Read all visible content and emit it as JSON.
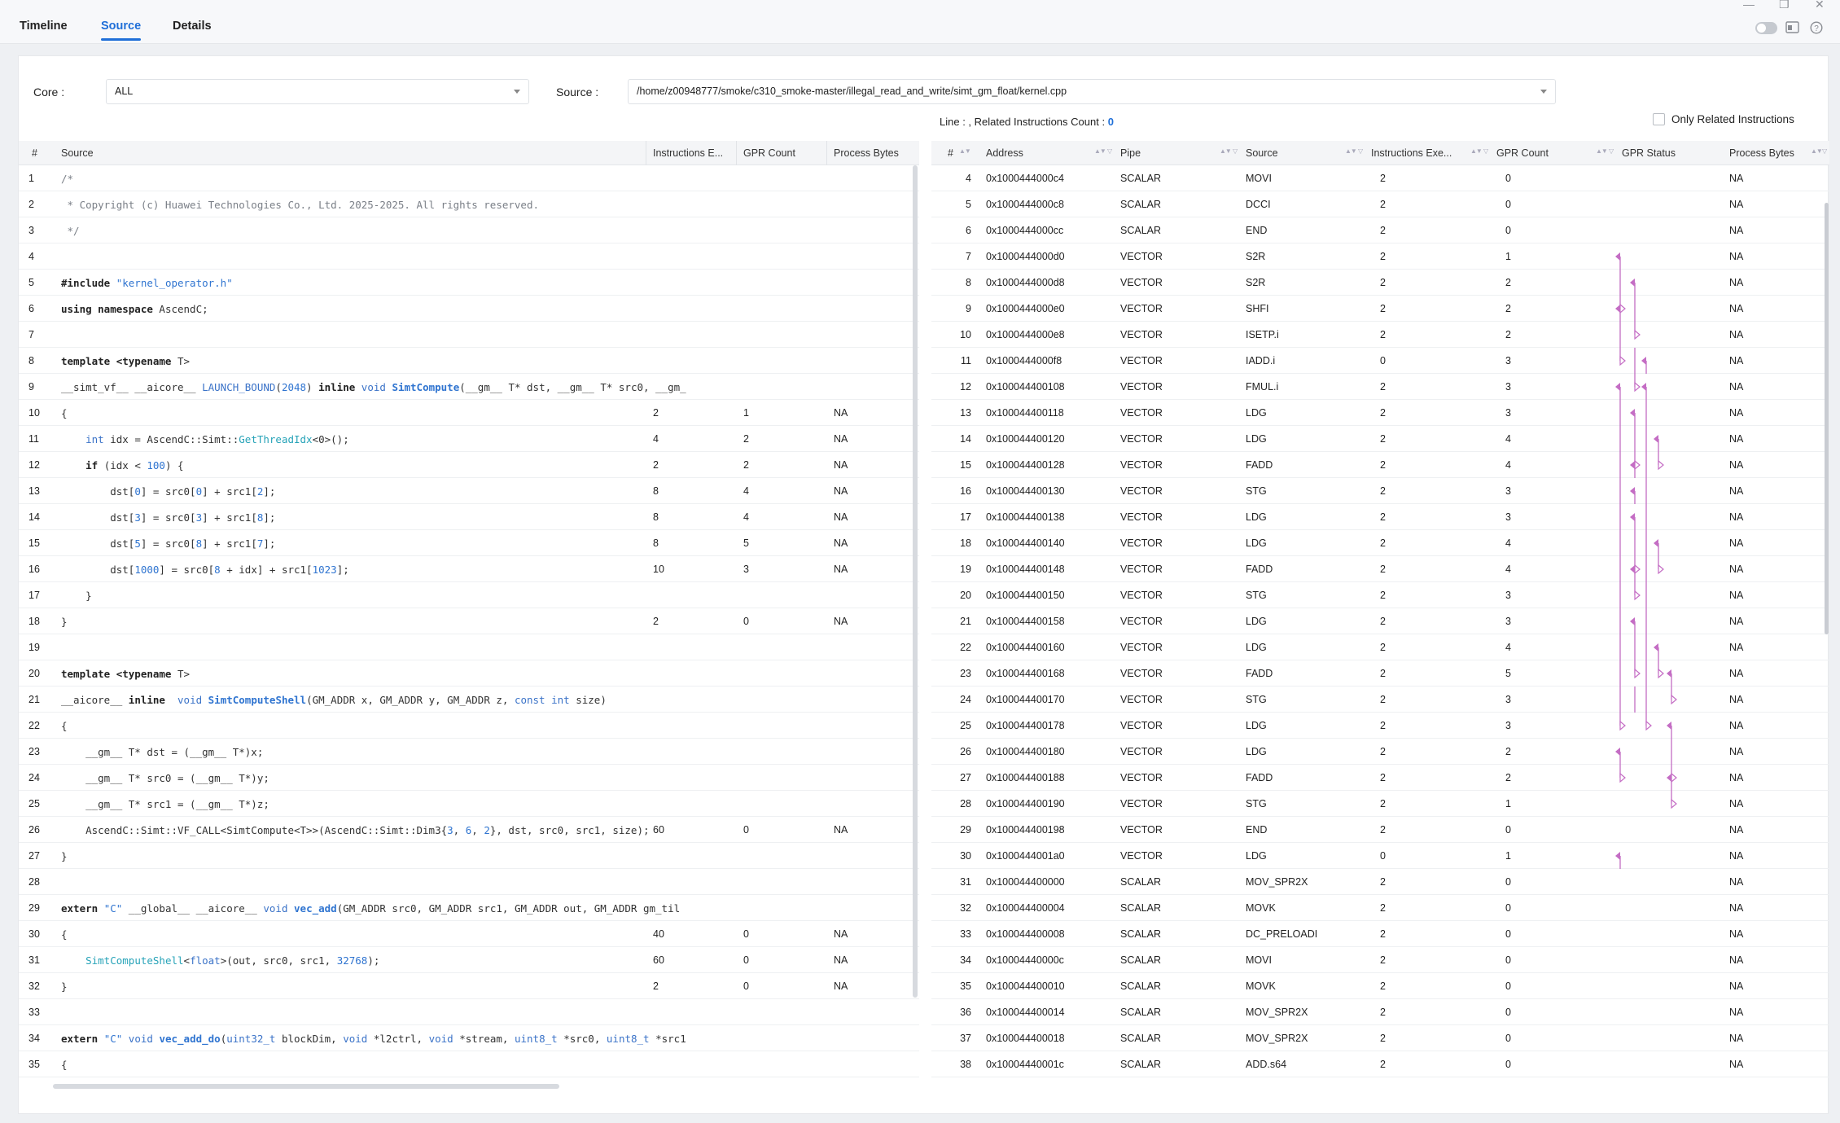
{
  "tabs": [
    {
      "label": "Timeline"
    },
    {
      "label": "Source"
    },
    {
      "label": "Details"
    }
  ],
  "filters": {
    "core_label": "Core :",
    "core_value": "ALL",
    "source_label": "Source :",
    "source_value": "/home/z00948777/smoke/c310_smoke-master/illegal_read_and_write/simt_gm_float/kernel.cpp"
  },
  "info": {
    "line_label": "Line : , Related Instructions Count :",
    "count": "0"
  },
  "only_related": {
    "label": "Only Related Instructions",
    "checked": false
  },
  "left_headers": [
    "#",
    "Source",
    "Instructions E...",
    "GPR Count",
    "Process Bytes"
  ],
  "right_headers": [
    "#",
    "Address",
    "Pipe",
    "Source",
    "Instructions Exe...",
    "GPR Count",
    "GPR Status",
    "Process Bytes"
  ],
  "source_rows": [
    {
      "n": "1",
      "src": [
        [
          "/*",
          "cm"
        ]
      ],
      "ie": "",
      "gpr": "",
      "pb": ""
    },
    {
      "n": "2",
      "src": [
        [
          " * Copyright (c) Huawei Technologies Co., Ltd. 2025-2025. All rights reserved.",
          "cm"
        ]
      ],
      "ie": "",
      "gpr": "",
      "pb": ""
    },
    {
      "n": "3",
      "src": [
        [
          " */",
          "cm"
        ]
      ],
      "ie": "",
      "gpr": "",
      "pb": ""
    },
    {
      "n": "4",
      "src": [],
      "ie": "",
      "gpr": "",
      "pb": ""
    },
    {
      "n": "5",
      "src": [
        [
          "#include ",
          "kw"
        ],
        [
          "\"kernel_operator.h\"",
          "str"
        ]
      ],
      "ie": "",
      "gpr": "",
      "pb": ""
    },
    {
      "n": "6",
      "src": [
        [
          "using namespace ",
          "kw"
        ],
        [
          "AscendC;",
          ""
        ]
      ],
      "ie": "",
      "gpr": "",
      "pb": ""
    },
    {
      "n": "7",
      "src": [],
      "ie": "",
      "gpr": "",
      "pb": ""
    },
    {
      "n": "8",
      "src": [
        [
          "template <typename ",
          "kw"
        ],
        [
          "T>",
          ""
        ]
      ],
      "ie": "",
      "gpr": "",
      "pb": ""
    },
    {
      "n": "9",
      "src": [
        [
          "__simt_vf__ __aicore__ ",
          ""
        ],
        [
          "LAUNCH_BOUND",
          "ty"
        ],
        [
          "(",
          ""
        ],
        [
          "2048",
          "num"
        ],
        [
          ") ",
          ""
        ],
        [
          "inline ",
          "kw"
        ],
        [
          "void ",
          "ty"
        ],
        [
          "SimtCompute",
          "fn"
        ],
        [
          "(__gm__ T* dst, __gm__ T* src0, __gm_",
          ""
        ]
      ],
      "ie": "",
      "gpr": "",
      "pb": ""
    },
    {
      "n": "10",
      "src": [
        [
          "{",
          ""
        ]
      ],
      "ie": "2",
      "gpr": "1",
      "pb": "NA"
    },
    {
      "n": "11",
      "src": [
        [
          "    ",
          ""
        ],
        [
          "int ",
          "ty"
        ],
        [
          "idx = AscendC::Simt::",
          ""
        ],
        [
          "GetThreadIdx",
          "ts"
        ],
        [
          "<0>();",
          ""
        ]
      ],
      "ie": "4",
      "gpr": "2",
      "pb": "NA"
    },
    {
      "n": "12",
      "src": [
        [
          "    ",
          ""
        ],
        [
          "if ",
          "kw"
        ],
        [
          "(idx < ",
          ""
        ],
        [
          "100",
          "num"
        ],
        [
          ") {",
          ""
        ]
      ],
      "ie": "2",
      "gpr": "2",
      "pb": "NA"
    },
    {
      "n": "13",
      "src": [
        [
          "        dst[",
          ""
        ],
        [
          "0",
          "num"
        ],
        [
          "] = src0[",
          ""
        ],
        [
          "0",
          "num"
        ],
        [
          "] + src1[",
          ""
        ],
        [
          "2",
          "num"
        ],
        [
          "];",
          ""
        ]
      ],
      "ie": "8",
      "gpr": "4",
      "pb": "NA"
    },
    {
      "n": "14",
      "src": [
        [
          "        dst[",
          ""
        ],
        [
          "3",
          "num"
        ],
        [
          "] = src0[",
          ""
        ],
        [
          "3",
          "num"
        ],
        [
          "] + src1[",
          ""
        ],
        [
          "8",
          "num"
        ],
        [
          "];",
          ""
        ]
      ],
      "ie": "8",
      "gpr": "4",
      "pb": "NA"
    },
    {
      "n": "15",
      "src": [
        [
          "        dst[",
          ""
        ],
        [
          "5",
          "num"
        ],
        [
          "] = src0[",
          ""
        ],
        [
          "8",
          "num"
        ],
        [
          "] + src1[",
          ""
        ],
        [
          "7",
          "num"
        ],
        [
          "];",
          ""
        ]
      ],
      "ie": "8",
      "gpr": "5",
      "pb": "NA"
    },
    {
      "n": "16",
      "src": [
        [
          "        dst[",
          ""
        ],
        [
          "1000",
          "num"
        ],
        [
          "] = src0[",
          ""
        ],
        [
          "8",
          "num"
        ],
        [
          " + idx] + src1[",
          ""
        ],
        [
          "1023",
          "num"
        ],
        [
          "];",
          ""
        ]
      ],
      "ie": "10",
      "gpr": "3",
      "pb": "NA"
    },
    {
      "n": "17",
      "src": [
        [
          "    }",
          ""
        ]
      ],
      "ie": "",
      "gpr": "",
      "pb": ""
    },
    {
      "n": "18",
      "src": [
        [
          "}",
          ""
        ]
      ],
      "ie": "2",
      "gpr": "0",
      "pb": "NA"
    },
    {
      "n": "19",
      "src": [],
      "ie": "",
      "gpr": "",
      "pb": ""
    },
    {
      "n": "20",
      "src": [
        [
          "template <typename ",
          "kw"
        ],
        [
          "T>",
          ""
        ]
      ],
      "ie": "",
      "gpr": "",
      "pb": ""
    },
    {
      "n": "21",
      "src": [
        [
          "__aicore__ ",
          ""
        ],
        [
          "inline  ",
          "kw"
        ],
        [
          "void ",
          "ty"
        ],
        [
          "SimtComputeShell",
          "fn"
        ],
        [
          "(GM_ADDR x, GM_ADDR y, GM_ADDR z, ",
          ""
        ],
        [
          "const int ",
          "ty"
        ],
        [
          "size)",
          ""
        ]
      ],
      "ie": "",
      "gpr": "",
      "pb": ""
    },
    {
      "n": "22",
      "src": [
        [
          "{",
          ""
        ]
      ],
      "ie": "",
      "gpr": "",
      "pb": ""
    },
    {
      "n": "23",
      "src": [
        [
          "    __gm__ T* dst = (__gm__ T*)x;",
          ""
        ]
      ],
      "ie": "",
      "gpr": "",
      "pb": ""
    },
    {
      "n": "24",
      "src": [
        [
          "    __gm__ T* src0 = (__gm__ T*)y;",
          ""
        ]
      ],
      "ie": "",
      "gpr": "",
      "pb": ""
    },
    {
      "n": "25",
      "src": [
        [
          "    __gm__ T* src1 = (__gm__ T*)z;",
          ""
        ]
      ],
      "ie": "",
      "gpr": "",
      "pb": ""
    },
    {
      "n": "26",
      "src": [
        [
          "    AscendC::Simt::VF_CALL<SimtCompute<T>>(AscendC::Simt::Dim3{",
          ""
        ],
        [
          "3",
          "num"
        ],
        [
          ", ",
          ""
        ],
        [
          "6",
          "num"
        ],
        [
          ", ",
          ""
        ],
        [
          "2",
          "num"
        ],
        [
          "}, dst, src0, src1, size);",
          ""
        ]
      ],
      "ie": "60",
      "gpr": "0",
      "pb": "NA"
    },
    {
      "n": "27",
      "src": [
        [
          "}",
          ""
        ]
      ],
      "ie": "",
      "gpr": "",
      "pb": ""
    },
    {
      "n": "28",
      "src": [],
      "ie": "",
      "gpr": "",
      "pb": ""
    },
    {
      "n": "29",
      "src": [
        [
          "extern ",
          "kw"
        ],
        [
          "\"C\" ",
          "str"
        ],
        [
          "__global__ __aicore__ ",
          ""
        ],
        [
          "void ",
          "ty"
        ],
        [
          "vec_add",
          "fn"
        ],
        [
          "(GM_ADDR src0, GM_ADDR src1, GM_ADDR out, GM_ADDR gm_til",
          ""
        ]
      ],
      "ie": "",
      "gpr": "",
      "pb": ""
    },
    {
      "n": "30",
      "src": [
        [
          "{",
          ""
        ]
      ],
      "ie": "40",
      "gpr": "0",
      "pb": "NA"
    },
    {
      "n": "31",
      "src": [
        [
          "    ",
          ""
        ],
        [
          "SimtComputeShell",
          "ts"
        ],
        [
          "<",
          ""
        ],
        [
          "float",
          "ty"
        ],
        [
          ">(out, src0, src1, ",
          ""
        ],
        [
          "32768",
          "num"
        ],
        [
          ");",
          ""
        ]
      ],
      "ie": "60",
      "gpr": "0",
      "pb": "NA"
    },
    {
      "n": "32",
      "src": [
        [
          "}",
          ""
        ]
      ],
      "ie": "2",
      "gpr": "0",
      "pb": "NA"
    },
    {
      "n": "33",
      "src": [],
      "ie": "",
      "gpr": "",
      "pb": ""
    },
    {
      "n": "34",
      "src": [
        [
          "extern ",
          "kw"
        ],
        [
          "\"C\" ",
          "str"
        ],
        [
          "void ",
          "ty"
        ],
        [
          "vec_add_do",
          "fn"
        ],
        [
          "(",
          ""
        ],
        [
          "uint32_t ",
          "ty"
        ],
        [
          "blockDim, ",
          ""
        ],
        [
          "void ",
          "ty"
        ],
        [
          "*l2ctrl, ",
          ""
        ],
        [
          "void ",
          "ty"
        ],
        [
          "*stream, ",
          ""
        ],
        [
          "uint8_t ",
          "ty"
        ],
        [
          "*src0, ",
          ""
        ],
        [
          "uint8_t ",
          "ty"
        ],
        [
          "*src1",
          ""
        ]
      ],
      "ie": "",
      "gpr": "",
      "pb": ""
    },
    {
      "n": "35",
      "src": [
        [
          "{",
          ""
        ]
      ],
      "ie": "",
      "gpr": "",
      "pb": ""
    }
  ],
  "instr_rows": [
    {
      "n": "4",
      "addr": "0x1000444000c4",
      "pipe": "SCALAR",
      "src": "MOVI",
      "ie": "2",
      "gpr": "0",
      "pb": "NA"
    },
    {
      "n": "5",
      "addr": "0x1000444000c8",
      "pipe": "SCALAR",
      "src": "DCCI",
      "ie": "2",
      "gpr": "0",
      "pb": "NA"
    },
    {
      "n": "6",
      "addr": "0x1000444000cc",
      "pipe": "SCALAR",
      "src": "END",
      "ie": "2",
      "gpr": "0",
      "pb": "NA"
    },
    {
      "n": "7",
      "addr": "0x1000444000d0",
      "pipe": "VECTOR",
      "src": "S2R",
      "ie": "2",
      "gpr": "1",
      "pb": "NA"
    },
    {
      "n": "8",
      "addr": "0x1000444000d8",
      "pipe": "VECTOR",
      "src": "S2R",
      "ie": "2",
      "gpr": "2",
      "pb": "NA"
    },
    {
      "n": "9",
      "addr": "0x1000444000e0",
      "pipe": "VECTOR",
      "src": "SHFI",
      "ie": "2",
      "gpr": "2",
      "pb": "NA"
    },
    {
      "n": "10",
      "addr": "0x1000444000e8",
      "pipe": "VECTOR",
      "src": "ISETP.i",
      "ie": "2",
      "gpr": "2",
      "pb": "NA"
    },
    {
      "n": "11",
      "addr": "0x1000444000f8",
      "pipe": "VECTOR",
      "src": "IADD.i",
      "ie": "0",
      "gpr": "3",
      "pb": "NA"
    },
    {
      "n": "12",
      "addr": "0x100044400108",
      "pipe": "VECTOR",
      "src": "FMUL.i",
      "ie": "2",
      "gpr": "3",
      "pb": "NA"
    },
    {
      "n": "13",
      "addr": "0x100044400118",
      "pipe": "VECTOR",
      "src": "LDG",
      "ie": "2",
      "gpr": "3",
      "pb": "NA"
    },
    {
      "n": "14",
      "addr": "0x100044400120",
      "pipe": "VECTOR",
      "src": "LDG",
      "ie": "2",
      "gpr": "4",
      "pb": "NA"
    },
    {
      "n": "15",
      "addr": "0x100044400128",
      "pipe": "VECTOR",
      "src": "FADD",
      "ie": "2",
      "gpr": "4",
      "pb": "NA"
    },
    {
      "n": "16",
      "addr": "0x100044400130",
      "pipe": "VECTOR",
      "src": "STG",
      "ie": "2",
      "gpr": "3",
      "pb": "NA"
    },
    {
      "n": "17",
      "addr": "0x100044400138",
      "pipe": "VECTOR",
      "src": "LDG",
      "ie": "2",
      "gpr": "3",
      "pb": "NA"
    },
    {
      "n": "18",
      "addr": "0x100044400140",
      "pipe": "VECTOR",
      "src": "LDG",
      "ie": "2",
      "gpr": "4",
      "pb": "NA"
    },
    {
      "n": "19",
      "addr": "0x100044400148",
      "pipe": "VECTOR",
      "src": "FADD",
      "ie": "2",
      "gpr": "4",
      "pb": "NA"
    },
    {
      "n": "20",
      "addr": "0x100044400150",
      "pipe": "VECTOR",
      "src": "STG",
      "ie": "2",
      "gpr": "3",
      "pb": "NA"
    },
    {
      "n": "21",
      "addr": "0x100044400158",
      "pipe": "VECTOR",
      "src": "LDG",
      "ie": "2",
      "gpr": "3",
      "pb": "NA"
    },
    {
      "n": "22",
      "addr": "0x100044400160",
      "pipe": "VECTOR",
      "src": "LDG",
      "ie": "2",
      "gpr": "4",
      "pb": "NA"
    },
    {
      "n": "23",
      "addr": "0x100044400168",
      "pipe": "VECTOR",
      "src": "FADD",
      "ie": "2",
      "gpr": "5",
      "pb": "NA"
    },
    {
      "n": "24",
      "addr": "0x100044400170",
      "pipe": "VECTOR",
      "src": "STG",
      "ie": "2",
      "gpr": "3",
      "pb": "NA"
    },
    {
      "n": "25",
      "addr": "0x100044400178",
      "pipe": "VECTOR",
      "src": "LDG",
      "ie": "2",
      "gpr": "3",
      "pb": "NA"
    },
    {
      "n": "26",
      "addr": "0x100044400180",
      "pipe": "VECTOR",
      "src": "LDG",
      "ie": "2",
      "gpr": "2",
      "pb": "NA"
    },
    {
      "n": "27",
      "addr": "0x100044400188",
      "pipe": "VECTOR",
      "src": "FADD",
      "ie": "2",
      "gpr": "2",
      "pb": "NA"
    },
    {
      "n": "28",
      "addr": "0x100044400190",
      "pipe": "VECTOR",
      "src": "STG",
      "ie": "2",
      "gpr": "1",
      "pb": "NA"
    },
    {
      "n": "29",
      "addr": "0x100044400198",
      "pipe": "VECTOR",
      "src": "END",
      "ie": "2",
      "gpr": "0",
      "pb": "NA"
    },
    {
      "n": "30",
      "addr": "0x1000444001a0",
      "pipe": "VECTOR",
      "src": "LDG",
      "ie": "0",
      "gpr": "1",
      "pb": "NA"
    },
    {
      "n": "31",
      "addr": "0x100044400000",
      "pipe": "SCALAR",
      "src": "MOV_SPR2X",
      "ie": "2",
      "gpr": "0",
      "pb": "NA"
    },
    {
      "n": "32",
      "addr": "0x100044400004",
      "pipe": "SCALAR",
      "src": "MOVK",
      "ie": "2",
      "gpr": "0",
      "pb": "NA"
    },
    {
      "n": "33",
      "addr": "0x100044400008",
      "pipe": "SCALAR",
      "src": "DC_PRELOADI",
      "ie": "2",
      "gpr": "0",
      "pb": "NA"
    },
    {
      "n": "34",
      "addr": "0x10004440000c",
      "pipe": "SCALAR",
      "src": "MOVI",
      "ie": "2",
      "gpr": "0",
      "pb": "NA"
    },
    {
      "n": "35",
      "addr": "0x100044400010",
      "pipe": "SCALAR",
      "src": "MOVK",
      "ie": "2",
      "gpr": "0",
      "pb": "NA"
    },
    {
      "n": "36",
      "addr": "0x100044400014",
      "pipe": "SCALAR",
      "src": "MOV_SPR2X",
      "ie": "2",
      "gpr": "0",
      "pb": "NA"
    },
    {
      "n": "37",
      "addr": "0x100044400018",
      "pipe": "SCALAR",
      "src": "MOV_SPR2X",
      "ie": "2",
      "gpr": "0",
      "pb": "NA"
    },
    {
      "n": "38",
      "addr": "0x10004440001c",
      "pipe": "SCALAR",
      "src": "ADD.s64",
      "ie": "2",
      "gpr": "0",
      "pb": "NA"
    }
  ],
  "gpr_marks": [
    [],
    [],
    [],
    [
      [
        0,
        "w"
      ]
    ],
    [
      [
        0,
        "l"
      ],
      [
        1,
        "w"
      ]
    ],
    [
      [
        0,
        "rw"
      ],
      [
        1,
        "l"
      ]
    ],
    [
      [
        0,
        "l"
      ],
      [
        1,
        "r"
      ]
    ],
    [
      [
        0,
        "r"
      ],
      [
        1,
        "l"
      ],
      [
        2,
        "w"
      ]
    ],
    [
      [
        0,
        "w"
      ],
      [
        1,
        "r"
      ],
      [
        2,
        "w"
      ]
    ],
    [
      [
        0,
        "l"
      ],
      [
        1,
        "w"
      ],
      [
        2,
        "l"
      ]
    ],
    [
      [
        0,
        "l"
      ],
      [
        1,
        "l"
      ],
      [
        2,
        "l"
      ],
      [
        3,
        "w"
      ]
    ],
    [
      [
        0,
        "l"
      ],
      [
        1,
        "rw"
      ],
      [
        2,
        "l"
      ],
      [
        3,
        "r"
      ]
    ],
    [
      [
        0,
        "l"
      ],
      [
        1,
        "w"
      ],
      [
        2,
        "l"
      ]
    ],
    [
      [
        0,
        "l"
      ],
      [
        1,
        "w"
      ],
      [
        2,
        "l"
      ]
    ],
    [
      [
        0,
        "l"
      ],
      [
        1,
        "l"
      ],
      [
        2,
        "l"
      ],
      [
        3,
        "w"
      ]
    ],
    [
      [
        0,
        "l"
      ],
      [
        1,
        "rw"
      ],
      [
        2,
        "l"
      ],
      [
        3,
        "r"
      ]
    ],
    [
      [
        0,
        "l"
      ],
      [
        1,
        "r"
      ],
      [
        2,
        "l"
      ]
    ],
    [
      [
        0,
        "l"
      ],
      [
        1,
        "w"
      ],
      [
        2,
        "l"
      ]
    ],
    [
      [
        0,
        "l"
      ],
      [
        1,
        "l"
      ],
      [
        2,
        "l"
      ],
      [
        3,
        "w"
      ]
    ],
    [
      [
        0,
        "l"
      ],
      [
        1,
        "r"
      ],
      [
        2,
        "l"
      ],
      [
        3,
        "r"
      ],
      [
        4,
        "w"
      ]
    ],
    [
      [
        0,
        "l"
      ],
      [
        1,
        "l"
      ],
      [
        2,
        "l"
      ],
      [
        4,
        "r"
      ]
    ],
    [
      [
        0,
        "r"
      ],
      [
        2,
        "r"
      ],
      [
        4,
        "w"
      ]
    ],
    [
      [
        0,
        "w"
      ],
      [
        4,
        "l"
      ]
    ],
    [
      [
        0,
        "r"
      ],
      [
        4,
        "rw"
      ]
    ],
    [
      [
        4,
        "r"
      ]
    ],
    [],
    [
      [
        0,
        "w"
      ]
    ],
    [],
    [],
    [],
    [],
    [],
    [],
    [],
    []
  ]
}
